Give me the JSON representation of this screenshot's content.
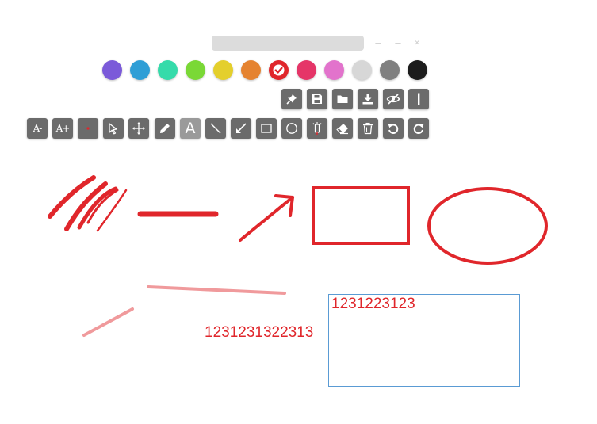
{
  "toolbar": {
    "window_buttons": {
      "minimize": "–",
      "maximize": "–",
      "close": "×"
    },
    "palette": [
      {
        "name": "purple",
        "color": "#7b5ad9"
      },
      {
        "name": "blue",
        "color": "#2f9ed6"
      },
      {
        "name": "teal",
        "color": "#35dbaa"
      },
      {
        "name": "green",
        "color": "#7ad836"
      },
      {
        "name": "yellow",
        "color": "#e4cf2c"
      },
      {
        "name": "orange",
        "color": "#e58330"
      },
      {
        "name": "red",
        "color": "#e0262b",
        "selected": true
      },
      {
        "name": "pink",
        "color": "#e53568"
      },
      {
        "name": "magenta",
        "color": "#e273cc"
      },
      {
        "name": "light-gray",
        "color": "#d7d7d7"
      },
      {
        "name": "gray",
        "color": "#808080"
      },
      {
        "name": "black",
        "color": "#1c1c1c"
      }
    ],
    "row1_tools": [
      "pin",
      "save",
      "open-folder",
      "download",
      "hide",
      "line-width"
    ],
    "row2_tools": [
      {
        "name": "font-decrease",
        "label": "A-"
      },
      {
        "name": "font-increase",
        "label": "A+"
      },
      {
        "name": "brush-size",
        "label": ""
      },
      {
        "name": "select",
        "label": ""
      },
      {
        "name": "move",
        "label": ""
      },
      {
        "name": "pen",
        "label": ""
      },
      {
        "name": "text",
        "label": "A",
        "active": true
      },
      {
        "name": "line",
        "label": ""
      },
      {
        "name": "arrow",
        "label": ""
      },
      {
        "name": "rectangle",
        "label": ""
      },
      {
        "name": "ellipse",
        "label": ""
      },
      {
        "name": "highlighter",
        "label": ""
      },
      {
        "name": "eraser",
        "label": ""
      },
      {
        "name": "delete",
        "label": ""
      },
      {
        "name": "undo",
        "label": ""
      },
      {
        "name": "redo",
        "label": ""
      }
    ]
  },
  "canvas": {
    "stroke_color": "#e0262b",
    "highlight_color": "#f09a9c",
    "free_text": "1231231322313",
    "text_box_text": "1231223123",
    "text_box_border": "#5a9bd4"
  }
}
